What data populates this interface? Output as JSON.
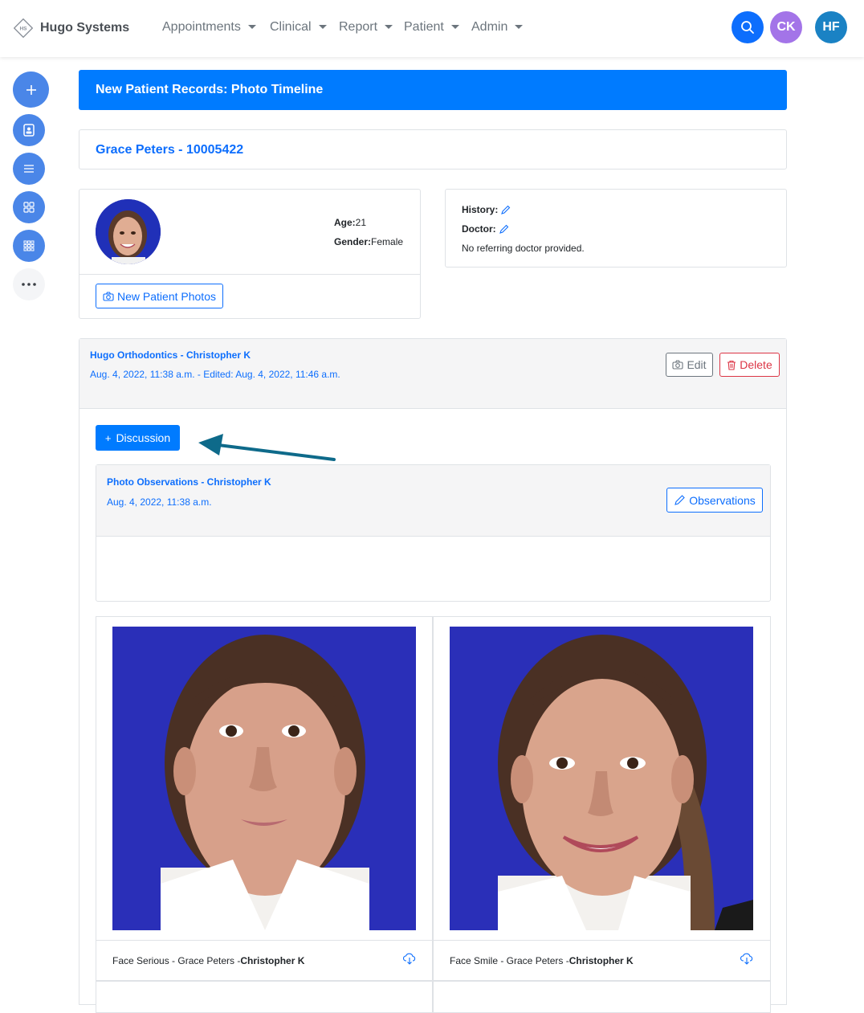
{
  "brand": {
    "name": "Hugo Systems",
    "logo_text": "HS"
  },
  "nav": {
    "menus": [
      "Appointments",
      "Clinical",
      "Report",
      "Patient",
      "Admin"
    ],
    "avatars": [
      {
        "initials": "CK",
        "color": "#a374e8"
      },
      {
        "initials": "HF",
        "color": "#1a82c4"
      }
    ],
    "search_color": "#0d6efd"
  },
  "sidebar": {
    "icons": [
      "plus-icon",
      "contact-card-icon",
      "list-icon",
      "grid-icon",
      "apps-grid-icon",
      "more-icon"
    ]
  },
  "banner": {
    "title": "New Patient Records: Photo Timeline"
  },
  "patient": {
    "header": "Grace Peters - 10005422",
    "age_label": "Age:",
    "age": "21",
    "gender_label": "Gender:",
    "gender": "Female",
    "new_photos_label": "New Patient Photos"
  },
  "info": {
    "history_label": "History:",
    "doctor_label": "Doctor:",
    "referring_text": "No referring doctor provided."
  },
  "record": {
    "title": "Hugo Orthodontics - Christopher K",
    "meta": "Aug. 4, 2022, 11:38 a.m. - Edited: Aug. 4, 2022, 11:46 a.m.",
    "edit_label": "Edit",
    "delete_label": "Delete",
    "discussion_label": "Discussion",
    "observations": {
      "title": "Photo Observations - Christopher K",
      "date": "Aug. 4, 2022, 11:38 a.m.",
      "button_label": "Observations"
    }
  },
  "photos": [
    {
      "caption_prefix": "Face Serious - Grace Peters -",
      "caption_author": "Christopher K"
    },
    {
      "caption_prefix": "Face Smile - Grace Peters -",
      "caption_author": "Christopher K"
    }
  ],
  "colors": {
    "primary": "#007bff",
    "link": "#0d6efd",
    "danger": "#dc3545",
    "sidebar": "#4a86e8",
    "arrow": "#0e6a8a",
    "photo_bg": "#2a2fb8"
  }
}
